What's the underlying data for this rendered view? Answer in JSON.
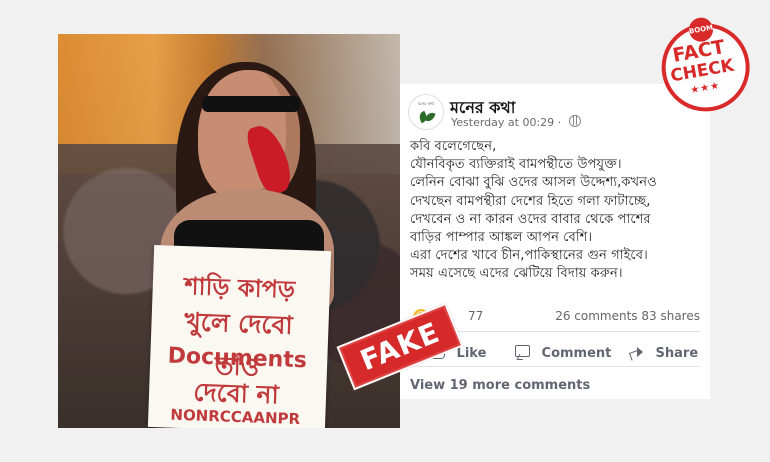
{
  "photo": {
    "sign_lines": [
      "শাড়ি কাপড়",
      "খুলে দেবো তাও",
      "Documents",
      "দেবো না",
      "NONRCCAANPR"
    ]
  },
  "post": {
    "page_name": "মনের কথা",
    "avatar_text": "মনের কথা",
    "timestamp": "Yesterday at 00:29 ·",
    "text_lines": [
      "কবি বলেগেছেন,",
      "যৌনবিকৃত ব্যক্তিরাই বামপন্থীতে উপযুক্ত।",
      "লেনিন বোঝা বুঝি ওদের আসল উদ্দেশ্য,কখনও",
      "দেখছেন বামপন্থীরা দেশের হিতে গলা ফাটাচ্ছে,",
      "দেখবেন ও না কারন ওদের বাবার থেকে পাশের",
      "বাড়ির পাম্পার আঙ্কল আপন বেশি।",
      "এরা দেশের খাবে চীন,পাকিস্থানের গুন গাইবে।",
      "সময় এসেছে এদের ঝেটিয়ে বিদায় করুন।"
    ],
    "reaction_count": "77",
    "comments_count": "26 comments",
    "shares_count": "83 shares",
    "actions": {
      "like": "Like",
      "comment": "Comment",
      "share": "Share"
    },
    "view_more": "View 19 more comments"
  },
  "stamps": {
    "fake": "FAKE",
    "badge_top": "BOOM",
    "badge_fact": "FACT",
    "badge_check": "CHECK",
    "badge_stars": "★★★"
  },
  "colors": {
    "accent_red": "#d92a2a",
    "facebook_blue": "#1877f2"
  },
  "icons": {
    "globe": "globe-icon",
    "like": "thumb-icon",
    "comment": "comment-icon",
    "share": "share-icon"
  }
}
